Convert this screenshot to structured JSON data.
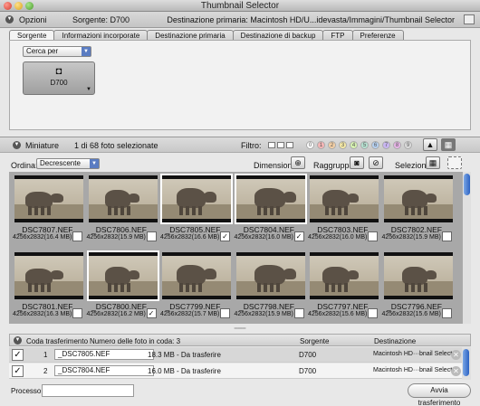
{
  "window": {
    "title": "Thumbnail Selector"
  },
  "options": {
    "title": "Opzioni",
    "source": "Sorgente: D700",
    "destination": "Destinazione primaria: Macintosh HD/U...idevasta/Immagini/Thumbnail Selector",
    "tabs": [
      "Sorgente",
      "Informazioni incorporate",
      "Destinazione primaria",
      "Destinazione di backup",
      "FTP",
      "Preferenze"
    ],
    "active_tab": "Sorgente",
    "search_select": "Cerca per",
    "camera_label": "D700"
  },
  "thumbs_header": {
    "title": "Miniature",
    "selection_count": "1 di 68 foto selezionate",
    "filter_label": "Filtro:",
    "ratings": [
      "0",
      "1",
      "2",
      "3",
      "4",
      "5",
      "6",
      "7",
      "8",
      "9"
    ],
    "order_label": "Ordina:",
    "order_value": "Decrescente",
    "dimensions_label": "Dimensioni:",
    "group_label": "Raggruppa:",
    "select_label": "Seleziona:"
  },
  "thumbnails": [
    {
      "name": "_DSC7807.NEF",
      "size": "4256x2832(16.4 MB)",
      "checked": ""
    },
    {
      "name": "_DSC7806.NEF",
      "size": "4256x2832(15.9 MB)",
      "checked": ""
    },
    {
      "name": "_DSC7805.NEF",
      "size": "4256x2832(16.6 MB)",
      "checked": "✓"
    },
    {
      "name": "_DSC7804.NEF",
      "size": "4256x2832(16.0 MB)",
      "checked": "✓"
    },
    {
      "name": "_DSC7803.NEF",
      "size": "4256x2832(16.0 MB)",
      "checked": ""
    },
    {
      "name": "_DSC7802.NEF",
      "size": "4256x2832(15.9 MB)",
      "checked": ""
    },
    {
      "name": "_DSC7801.NEF",
      "size": "4256x2832(16.3 MB)",
      "checked": ""
    },
    {
      "name": "_DSC7800.NEF",
      "size": "4256x2832(16.2 MB)",
      "checked": "✓"
    },
    {
      "name": "_DSC7799.NEF",
      "size": "4256x2832(15.7 MB)",
      "checked": ""
    },
    {
      "name": "_DSC7798.NEF",
      "size": "4256x2832(15.9 MB)",
      "checked": ""
    },
    {
      "name": "_DSC7797.NEF",
      "size": "4256x2832(15.6 MB)",
      "checked": ""
    },
    {
      "name": "_DSC7796.NEF",
      "size": "4256x2832(15.6 MB)",
      "checked": ""
    }
  ],
  "queue": {
    "title": "Coda trasferimento",
    "count_label": "Numero delle foto in coda: 3",
    "source_col": "Sorgente",
    "dest_col": "Destinazione",
    "rows": [
      {
        "check": "✓",
        "index": "1",
        "file": "_DSC7805.NEF",
        "size": "18.3 MB - Da trasferire",
        "source": "D700",
        "dest": "Macintosh HD···bnail Selector"
      },
      {
        "check": "✓",
        "index": "2",
        "file": "_DSC7804.NEF",
        "size": "16.0 MB - Da trasferire",
        "source": "D700",
        "dest": "Macintosh HD···bnail Selector"
      }
    ]
  },
  "footer": {
    "process_label": "Processo:",
    "start_button": "Avvia trasferimento"
  }
}
